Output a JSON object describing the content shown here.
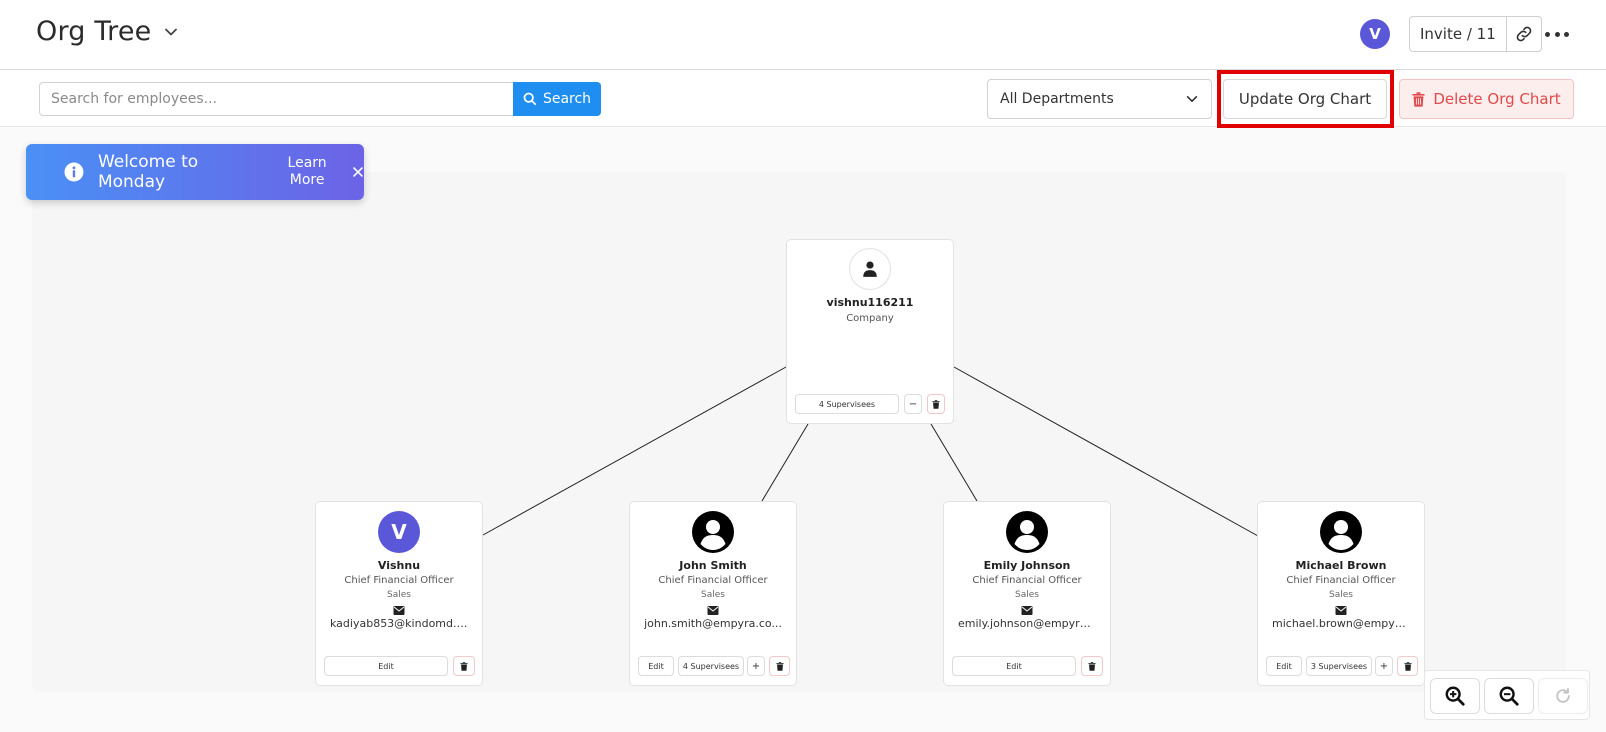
{
  "header": {
    "title": "Org Tree",
    "avatar_initial": "V",
    "invite_label": "Invite / 11"
  },
  "toolbar": {
    "search_placeholder": "Search for employees...",
    "search_label": "Search",
    "department_selected": "All Departments",
    "update_label": "Update Org Chart",
    "delete_label": "Delete Org Chart"
  },
  "toast": {
    "message": "Welcome to Monday",
    "link": "Learn More"
  },
  "org": {
    "root": {
      "name": "vishnu116211",
      "subtitle": "Company",
      "supervisees": "4 Supervisees",
      "collapse_symbol": "−"
    },
    "employees": [
      {
        "name": "Vishnu",
        "avatar_initial": "V",
        "title": "Chief Financial Officer",
        "department": "Sales",
        "email": "kadiyab853@kindomd.c...",
        "edit": "Edit",
        "supervisees": ""
      },
      {
        "name": "John Smith",
        "avatar_initial": "",
        "title": "Chief Financial Officer",
        "department": "Sales",
        "email": "john.smith@empyra.co...",
        "edit": "Edit",
        "supervisees": "4 Supervisees",
        "expand_symbol": "+"
      },
      {
        "name": "Emily Johnson",
        "avatar_initial": "",
        "title": "Chief Financial Officer",
        "department": "Sales",
        "email": "emily.johnson@empyra...",
        "edit": "Edit",
        "supervisees": ""
      },
      {
        "name": "Michael Brown",
        "avatar_initial": "",
        "title": "Chief Financial Officer",
        "department": "Sales",
        "email": "michael.brown@empyra...",
        "edit": "Edit",
        "supervisees": "3 Supervisees",
        "expand_symbol": "+"
      }
    ]
  },
  "colors": {
    "primary": "#1e8ff0",
    "avatar": "#5a57d8",
    "danger": "#e04a4a",
    "highlight": "#e00000"
  }
}
